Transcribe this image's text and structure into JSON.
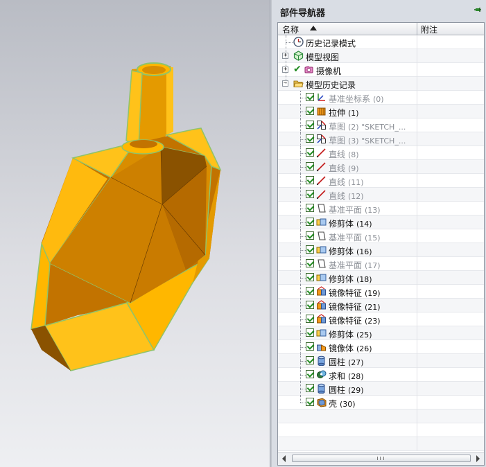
{
  "navigator": {
    "title": "部件导航器",
    "columns": {
      "name": "名称",
      "note": "附注"
    }
  },
  "tree": [
    {
      "label": "历史记录模式",
      "num": "",
      "icon": "clock-icon",
      "gray": false,
      "checked": false,
      "expander": ""
    },
    {
      "label": "模型视图",
      "num": "",
      "icon": "model-view-icon",
      "gray": false,
      "checked": false,
      "expander": "+"
    },
    {
      "label": "摄像机",
      "num": "",
      "icon": "camera-icon",
      "gray": false,
      "checked": false,
      "expander": "+"
    },
    {
      "label": "模型历史记录",
      "num": "",
      "icon": "folder-open-icon",
      "gray": false,
      "checked": false,
      "expander": "−"
    },
    {
      "label": "基准坐标系",
      "num": "(0)",
      "icon": "datum-csys-icon",
      "gray": true,
      "checked": true
    },
    {
      "label": "拉伸",
      "num": "(1)",
      "icon": "extrude-icon",
      "gray": false,
      "checked": true
    },
    {
      "label": "草图",
      "num": "(2) \"SKETCH_...",
      "icon": "sketch-icon",
      "gray": true,
      "checked": true
    },
    {
      "label": "草图",
      "num": "(3) \"SKETCH_...",
      "icon": "sketch-icon",
      "gray": true,
      "checked": true
    },
    {
      "label": "直线",
      "num": "(8)",
      "icon": "line-icon",
      "gray": true,
      "checked": true
    },
    {
      "label": "直线",
      "num": "(9)",
      "icon": "line-icon",
      "gray": true,
      "checked": true
    },
    {
      "label": "直线",
      "num": "(11)",
      "icon": "line-icon",
      "gray": true,
      "checked": true
    },
    {
      "label": "直线",
      "num": "(12)",
      "icon": "line-icon",
      "gray": true,
      "checked": true
    },
    {
      "label": "基准平面",
      "num": "(13)",
      "icon": "datum-plane-icon",
      "gray": true,
      "checked": true
    },
    {
      "label": "修剪体",
      "num": "(14)",
      "icon": "trim-body-icon",
      "gray": false,
      "checked": true
    },
    {
      "label": "基准平面",
      "num": "(15)",
      "icon": "datum-plane-icon",
      "gray": true,
      "checked": true
    },
    {
      "label": "修剪体",
      "num": "(16)",
      "icon": "trim-body-icon",
      "gray": false,
      "checked": true
    },
    {
      "label": "基准平面",
      "num": "(17)",
      "icon": "datum-plane-icon",
      "gray": true,
      "checked": true
    },
    {
      "label": "修剪体",
      "num": "(18)",
      "icon": "trim-body-icon",
      "gray": false,
      "checked": true
    },
    {
      "label": "镜像特征",
      "num": "(19)",
      "icon": "mirror-feature-icon",
      "gray": false,
      "checked": true
    },
    {
      "label": "镜像特征",
      "num": "(21)",
      "icon": "mirror-feature-icon",
      "gray": false,
      "checked": true
    },
    {
      "label": "镜像特征",
      "num": "(23)",
      "icon": "mirror-feature-icon",
      "gray": false,
      "checked": true
    },
    {
      "label": "修剪体",
      "num": "(25)",
      "icon": "trim-body-icon",
      "gray": false,
      "checked": true
    },
    {
      "label": "镜像体",
      "num": "(26)",
      "icon": "mirror-body-icon",
      "gray": false,
      "checked": true
    },
    {
      "label": "圆柱",
      "num": "(27)",
      "icon": "cylinder-icon",
      "gray": false,
      "checked": true
    },
    {
      "label": "求和",
      "num": "(28)",
      "icon": "unite-icon",
      "gray": false,
      "checked": true
    },
    {
      "label": "圆柱",
      "num": "(29)",
      "icon": "cylinder-icon",
      "gray": false,
      "checked": true
    },
    {
      "label": "壳",
      "num": "(30)",
      "icon": "shell-icon",
      "gray": false,
      "checked": true
    }
  ],
  "colors": {
    "part_main": "#ffb700",
    "part_dark": "#c97b00",
    "part_shadow": "#8a5200",
    "part_edge": "#8fc36a",
    "check_green": "#1e8a1e"
  }
}
